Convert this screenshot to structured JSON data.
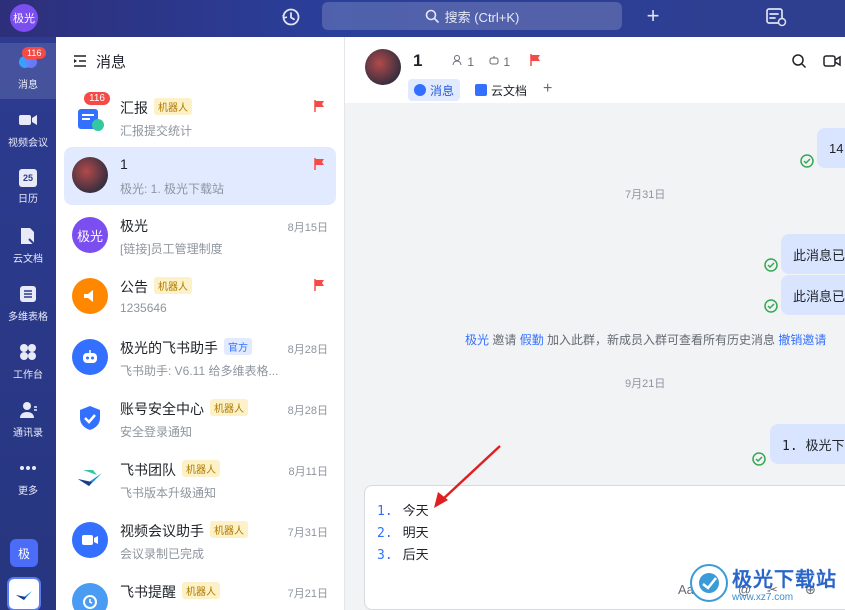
{
  "topbar": {
    "avatar_text": "极光",
    "search_placeholder": "搜索 (Ctrl+K)",
    "plus_label": "+"
  },
  "leftnav": {
    "items": [
      {
        "label": "消息",
        "icon": "chat-bubble-icon",
        "badge": "116"
      },
      {
        "label": "视频会议",
        "icon": "video-camera-icon"
      },
      {
        "label": "日历",
        "icon": "calendar-icon",
        "day": "25"
      },
      {
        "label": "云文档",
        "icon": "cloud-doc-icon"
      },
      {
        "label": "多维表格",
        "icon": "table-icon"
      },
      {
        "label": "工作台",
        "icon": "workspace-grid-icon"
      },
      {
        "label": "通讯录",
        "icon": "contacts-icon"
      },
      {
        "label": "更多",
        "icon": "more-dots-icon"
      }
    ],
    "bottom_avatar_text": "极"
  },
  "message_list": {
    "title": "消息",
    "items": [
      {
        "name": "汇报",
        "tag": "机器人",
        "tag_type": "bot",
        "preview": "汇报提交统计",
        "date": "",
        "flag": true,
        "badge": "116",
        "avatar_color": "#3370ff"
      },
      {
        "name": "1",
        "tag": "",
        "preview": "极光: 1. 极光下载站",
        "date": "",
        "flag": true,
        "active": true,
        "avatar_color": "#5a3a3a"
      },
      {
        "name": "极光",
        "tag": "",
        "preview": "[链接]员工管理制度",
        "date": "8月15日",
        "flag": false,
        "avatar_text": "极光",
        "avatar_color": "#7b4ef0"
      },
      {
        "name": "公告",
        "tag": "机器人",
        "tag_type": "bot",
        "preview": "1235646",
        "date": "",
        "flag": true,
        "avatar_color": "#ff8800"
      },
      {
        "name": "极光的飞书助手",
        "tag": "官方",
        "tag_type": "official",
        "preview": "飞书助手: V6.11 给多维表格...",
        "date": "8月28日",
        "flag": false,
        "avatar_color": "#3370ff"
      },
      {
        "name": "账号安全中心",
        "tag": "机器人",
        "tag_type": "bot",
        "preview": "安全登录通知",
        "date": "8月28日",
        "flag": false,
        "avatar_color": "#ffffff"
      },
      {
        "name": "飞书团队",
        "tag": "机器人",
        "tag_type": "bot",
        "preview": "飞书版本升级通知",
        "date": "8月11日",
        "flag": false,
        "avatar_color": "#ffffff"
      },
      {
        "name": "视频会议助手",
        "tag": "机器人",
        "tag_type": "bot",
        "preview": "会议录制已完成",
        "date": "7月31日",
        "flag": false,
        "avatar_color": "#3370ff"
      },
      {
        "name": "飞书提醒",
        "tag": "机器人",
        "tag_type": "bot",
        "preview": "",
        "date": "7月21日",
        "flag": false,
        "avatar_color": "#4a9cf2"
      }
    ]
  },
  "chat": {
    "title": "1",
    "member_count": "1",
    "bot_count": "1",
    "tabs": [
      {
        "label": "消息",
        "active": true
      },
      {
        "label": "云文档",
        "active": false
      }
    ],
    "tab_add": "+",
    "messages": [
      {
        "text": "14",
        "type": "bubble"
      },
      {
        "text": "7月31日",
        "type": "date"
      },
      {
        "text": "此消息已",
        "type": "bubble"
      },
      {
        "text": "此消息已",
        "type": "bubble"
      },
      {
        "text": "9月21日",
        "type": "date"
      },
      {
        "text": "1. 极光下",
        "type": "bubble"
      }
    ],
    "system_message": {
      "user": "极光",
      "mid": " 邀请 ",
      "invitee": "假勤",
      "text": " 加入此群，新成员入群可查看所有历史消息 ",
      "action": "撤销邀请"
    },
    "composer": {
      "lines": [
        {
          "num": "1.",
          "text": "今天"
        },
        {
          "num": "2.",
          "text": "明天"
        },
        {
          "num": "3.",
          "text": "后天"
        }
      ],
      "tools": [
        "Aa",
        "☺",
        "@",
        "✂",
        "⊕"
      ]
    }
  },
  "watermark": {
    "main": "极光下载站",
    "sub": "www.xz7.com"
  },
  "colors": {
    "accent": "#3370ff",
    "flag": "#f54a45",
    "topbar": "#2b3a8c",
    "bubble": "#d9e5ff"
  }
}
